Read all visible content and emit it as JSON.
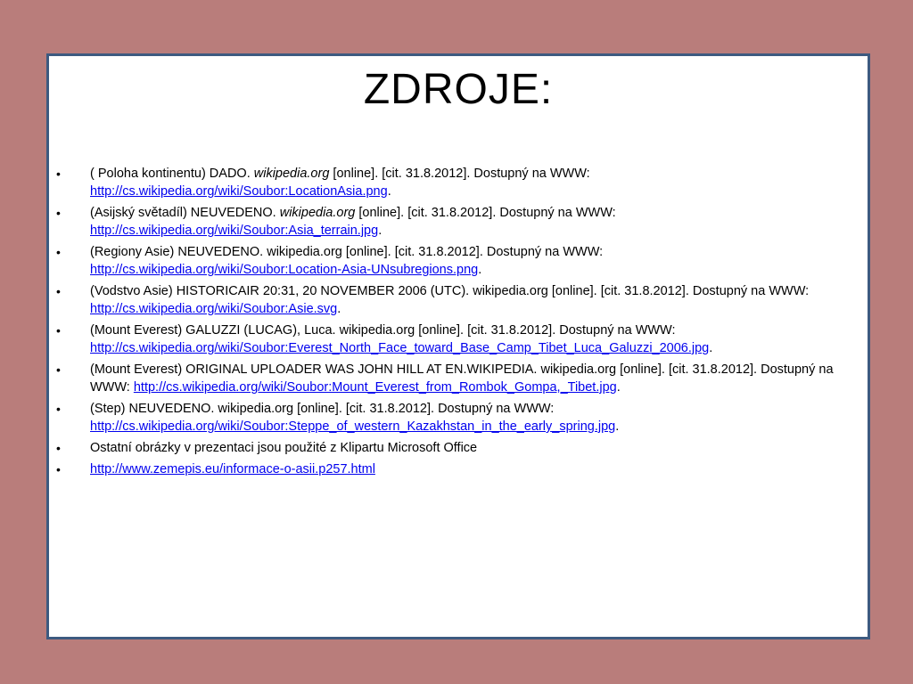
{
  "slide": {
    "title": "ZDROJE:",
    "bullet": "•",
    "items": [
      {
        "pre": "( Poloha kontinentu) DADO. ",
        "italic": "wikipedia.org",
        "post": " [online]. [cit. 31.8.2012]. Dostupný na WWW: ",
        "link": "http://cs.wikipedia.org/wiki/Soubor:LocationAsia.png",
        "end": "."
      },
      {
        "pre": "(Asijský světadíl) NEUVEDENO. ",
        "italic": "wikipedia.org",
        "post": " [online]. [cit. 31.8.2012]. Dostupný na WWW: ",
        "link": "http://cs.wikipedia.org/wiki/Soubor:Asia_terrain.jpg",
        "end": "."
      },
      {
        "pre": "(Regiony Asie) NEUVEDENO. wikipedia.org [online]. [cit. 31.8.2012]. Dostupný na WWW: ",
        "link": "http://cs.wikipedia.org/wiki/Soubor:Location-Asia-UNsubregions.png",
        "end": "."
      },
      {
        "pre": " (Vodstvo Asie) HISTORICAIR 20:31, 20 NOVEMBER 2006 (UTC). wikipedia.org [online]. [cit. 31.8.2012]. Dostupný na WWW: ",
        "link": "http://cs.wikipedia.org/wiki/Soubor:Asie.svg",
        "end": "."
      },
      {
        "pre": "(Mount Everest) GALUZZI (LUCAG), Luca. wikipedia.org [online]. [cit. 31.8.2012]. Dostupný na WWW: ",
        "link": "http://cs.wikipedia.org/wiki/Soubor:Everest_North_Face_toward_Base_Camp_Tibet_Luca_Galuzzi_2006.jpg",
        "end": "."
      },
      {
        "pre": "(Mount Everest) ORIGINAL UPLOADER WAS JOHN HILL AT EN.WIKIPEDIA. wikipedia.org [online]. [cit. 31.8.2012]. Dostupný na WWW: ",
        "link": "http://cs.wikipedia.org/wiki/Soubor:Mount_Everest_from_Rombok_Gompa,_Tibet.jpg",
        "end": "."
      },
      {
        "pre": "(Step) NEUVEDENO. wikipedia.org [online]. [cit. 31.8.2012]. Dostupný na WWW: ",
        "link": "http://cs.wikipedia.org/wiki/Soubor:Steppe_of_western_Kazakhstan_in_the_early_spring.jpg",
        "end": "."
      },
      {
        "pre": "Ostatní obrázky v prezentaci jsou použité z  Klipartu Microsoft Office"
      },
      {
        "link": "http://www.zemepis.eu/informace-o-asii.p257.html"
      }
    ]
  },
  "colors": {
    "background": "#b97d7b",
    "slide": "#ffffff",
    "border": "#3d5a80",
    "link": "#0000ee"
  }
}
